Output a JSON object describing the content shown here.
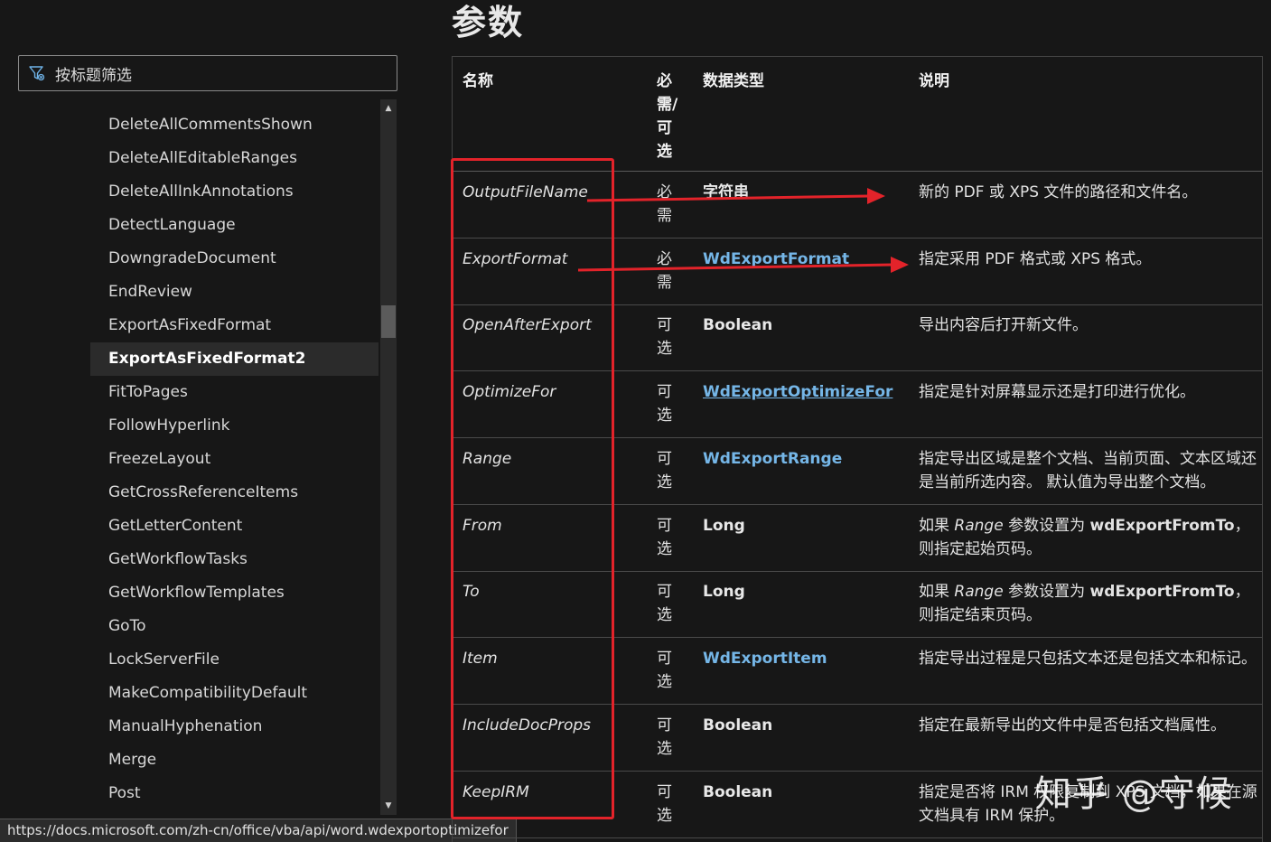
{
  "filter": {
    "placeholder": "按标题筛选"
  },
  "toc": {
    "items": [
      "DeleteAllCommentsShown",
      "DeleteAllEditableRanges",
      "DeleteAllInkAnnotations",
      "DetectLanguage",
      "DowngradeDocument",
      "EndReview",
      "ExportAsFixedFormat",
      "ExportAsFixedFormat2",
      "FitToPages",
      "FollowHyperlink",
      "FreezeLayout",
      "GetCrossReferenceItems",
      "GetLetterContent",
      "GetWorkflowTasks",
      "GetWorkflowTemplates",
      "GoTo",
      "LockServerFile",
      "MakeCompatibilityDefault",
      "ManualHyphenation",
      "Merge",
      "Post"
    ],
    "active": "ExportAsFixedFormat2"
  },
  "status_url": "https://docs.microsoft.com/zh-cn/office/vba/api/word.wdexportoptimizefor",
  "heading": "参数",
  "table": {
    "headers": {
      "name": "名称",
      "required": "必需/可选",
      "type": "数据类型",
      "description": "说明"
    },
    "rows": [
      {
        "name": "OutputFileName",
        "required": "必需",
        "type": "字符串",
        "type_style": "plain",
        "description": "新的 PDF 或 XPS 文件的路径和文件名。"
      },
      {
        "name": "ExportFormat",
        "required": "必需",
        "type": "WdExportFormat",
        "type_style": "link",
        "description": "指定采用 PDF 格式或 XPS 格式。"
      },
      {
        "name": "OpenAfterExport",
        "required": "可选",
        "type": "Boolean",
        "type_style": "plain",
        "description": "导出内容后打开新文件。"
      },
      {
        "name": "OptimizeFor",
        "required": "可选",
        "type": "WdExportOptimizeFor",
        "type_style": "link-underline",
        "description": "指定是针对屏幕显示还是打印进行优化。"
      },
      {
        "name": "Range",
        "required": "可选",
        "type": "WdExportRange",
        "type_style": "link",
        "description": "指定导出区域是整个文档、当前页面、文本区域还是当前所选内容。 默认值为导出整个文档。"
      },
      {
        "name": "From",
        "required": "可选",
        "type": "Long",
        "type_style": "plain",
        "desc_parts": [
          "如果 ",
          "Range",
          " 参数设置为 ",
          "wdExportFromTo",
          "，则指定起始页码。"
        ]
      },
      {
        "name": "To",
        "required": "可选",
        "type": "Long",
        "type_style": "plain",
        "desc_parts": [
          "如果 ",
          "Range",
          " 参数设置为 ",
          "wdExportFromTo",
          "，则指定结束页码。"
        ]
      },
      {
        "name": "Item",
        "required": "可选",
        "type": "WdExportItem",
        "type_style": "link",
        "description": "指定导出过程是只包括文本还是包括文本和标记。"
      },
      {
        "name": "IncludeDocProps",
        "required": "可选",
        "type": "Boolean",
        "type_style": "plain",
        "description": "指定在最新导出的文件中是否包括文档属性。"
      },
      {
        "name": "KeepIRM",
        "required": "可选",
        "type": "Boolean",
        "type_style": "plain",
        "description": "指定是否将 IRM 权限复制到 XPS 文档，如果在源文档具有 IRM 保护。"
      }
    ]
  },
  "watermark": "知乎 @守候",
  "colors": {
    "annotation_red": "#e3232a",
    "link_blue": "#75b6e7",
    "background": "#171717"
  }
}
